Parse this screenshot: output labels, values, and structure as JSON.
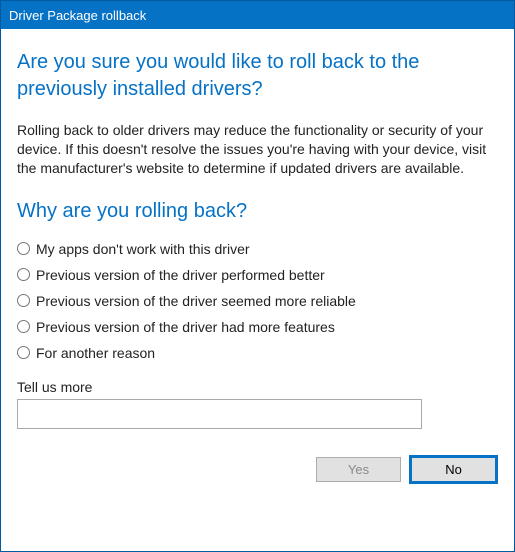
{
  "titlebar": {
    "title": "Driver Package rollback"
  },
  "headings": {
    "main": "Are you sure you would like to roll back to the previously installed drivers?",
    "sub": "Why are you rolling back?"
  },
  "body": "Rolling back to older drivers may reduce the functionality or security of your device.  If this doesn't resolve the issues you're having with your device, visit the manufacturer's website to determine if updated drivers are available.",
  "options": [
    "My apps don't work with this driver",
    "Previous version of the driver performed better",
    "Previous version of the driver seemed more reliable",
    "Previous version of the driver had more features",
    "For another reason"
  ],
  "tellmore": {
    "label": "Tell us more",
    "value": ""
  },
  "buttons": {
    "yes": "Yes",
    "no": "No"
  }
}
